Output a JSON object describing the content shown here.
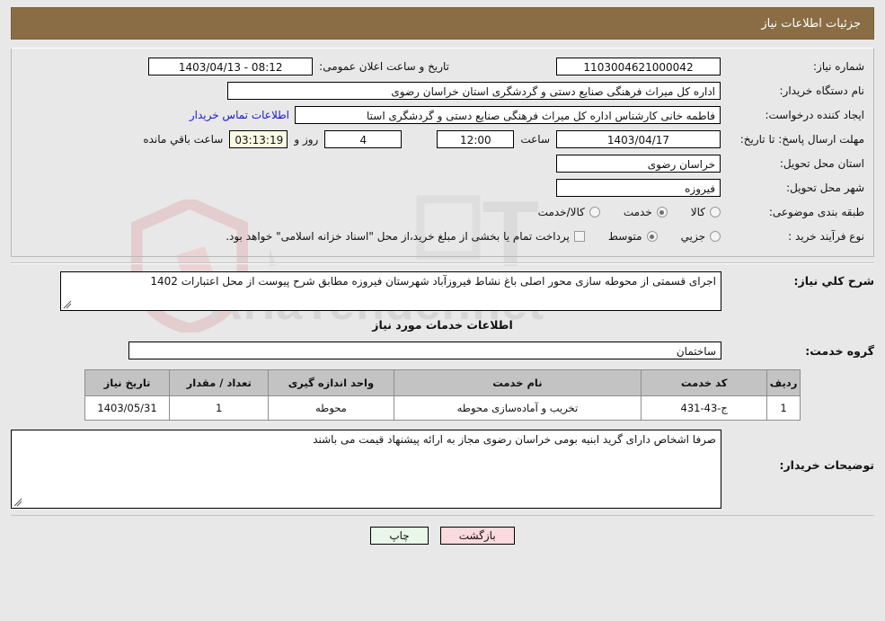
{
  "header": {
    "title": "جزئیات اطلاعات نیاز",
    "bar_color": "#8a6d44"
  },
  "watermark": {
    "text": "AriaTender.net",
    "color": "#c8c8c8"
  },
  "summary": {
    "need_number_label": "شماره نیاز:",
    "need_number_value": "1103004621000042",
    "announce_label": "تاریخ و ساعت اعلان عمومی:",
    "announce_value": "1403/04/13 - 08:12",
    "buyer_org_label": "نام دستگاه خریدار:",
    "buyer_org_value": "اداره کل میراث فرهنگی  صنایع دستی و گردشگری استان خراسان رضوی",
    "creator_label": "ایجاد کننده درخواست:",
    "creator_value": "فاطمه خانی کارشناس اداره کل میراث فرهنگی  صنایع دستی و گردشگری استا",
    "contact_link": "اطلاعات تماس خریدار",
    "deadline_label": "مهلت ارسال پاسخ: تا تاریخ:",
    "deadline_date": "1403/04/17",
    "hour_label": "ساعت",
    "deadline_time": "12:00",
    "days_value": "4",
    "days_label": "روز و",
    "countdown_value": "03:13:19",
    "countdown_label": "ساعت باقي مانده",
    "province_label": "استان محل تحویل:",
    "province_value": "خراسان رضوی",
    "city_label": "شهر محل تحویل:",
    "city_value": "فیروزه",
    "category_label": "طبقه بندی موضوعی:",
    "category_options": [
      {
        "label": "کالا",
        "selected": false
      },
      {
        "label": "خدمت",
        "selected": true
      },
      {
        "label": "کالا/خدمت",
        "selected": false
      }
    ],
    "process_label": "نوع فرآیند خرید :",
    "process_options": [
      {
        "label": "جزیي",
        "selected": false
      },
      {
        "label": "متوسط",
        "selected": true
      }
    ],
    "treasury_checkbox_label": "پرداخت تمام یا بخشی از مبلغ خرید،از محل \"اسناد خزانه اسلامی\" خواهد بود.",
    "treasury_checked": false
  },
  "description": {
    "label": "شرح کلي نیاز:",
    "value": "اجرای قسمتی از محوطه سازی محور اصلی باغ نشاط فیروزآباد شهرستان فیروزه مطابق شرح پیوست از محل اعتبارات 1402"
  },
  "services": {
    "section_title": "اطلاعات خدمات مورد نیاز",
    "group_label": "گروه خدمت:",
    "group_value": "ساختمان",
    "columns": [
      "ردیف",
      "کد خدمت",
      "نام خدمت",
      "واحد اندازه گیری",
      "تعداد / مقدار",
      "تاریخ نیاز"
    ],
    "rows": [
      {
        "index": "1",
        "code": "ج-43-431",
        "name": "تخریب و آماده‌سازی محوطه",
        "unit": "محوطه",
        "quantity": "1",
        "need_date": "1403/05/31"
      }
    ]
  },
  "buyer_notes": {
    "label": "توضیحات خریدار:",
    "value": "صرفا اشخاص دارای گرید ابنیه بومی خراسان رضوی مجاز به ارائه پیشنهاد قیمت می باشند"
  },
  "footer": {
    "print_label": "چاپ",
    "back_label": "بازگشت"
  }
}
